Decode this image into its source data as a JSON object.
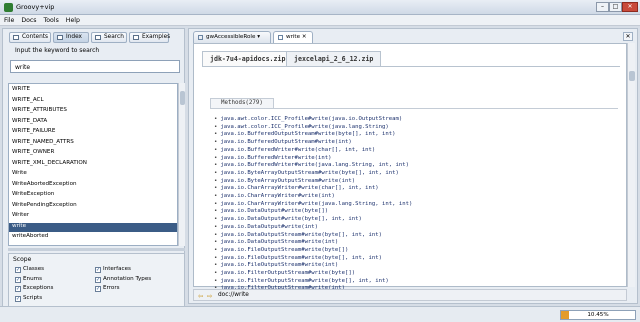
{
  "window": {
    "title": "Groovy+vip"
  },
  "menu": [
    "File",
    "Docs",
    "Tools",
    "Help"
  ],
  "left_tabs": [
    "Contents",
    "Index",
    "Search",
    "Examples"
  ],
  "keyword": {
    "label": "Input the keyword to search",
    "value": "write"
  },
  "index_list": [
    "WRITE",
    "WRITE_ACL",
    "WRITE_ATTRIBUTES",
    "WRITE_DATA",
    "WRITE_FAILURE",
    "WRITE_NAMED_ATTRS",
    "WRITE_OWNER",
    "WRITE_XML_DECLARATION",
    "Write",
    "WriteAbortedException",
    "WriteException",
    "WritePendingException",
    "Writer",
    "write",
    "writeAborted"
  ],
  "selected_index": 13,
  "scope": {
    "title": "Scope",
    "options": [
      {
        "label": "Classes",
        "checked": true
      },
      {
        "label": "Interfaces",
        "checked": true
      },
      {
        "label": "Enums",
        "checked": true
      },
      {
        "label": "Annotation Types",
        "checked": true
      },
      {
        "label": "Exceptions",
        "checked": true
      },
      {
        "label": "Errors",
        "checked": true
      },
      {
        "label": "Scripts",
        "checked": true
      }
    ]
  },
  "doc_tabs": [
    {
      "label": "gwAccessibleRole",
      "active": false
    },
    {
      "label": "write",
      "active": true
    }
  ],
  "jar_tabs": [
    "jdk-7u4-apidocs.zip",
    "jexcelapi_2_6_12.zip"
  ],
  "methods_tab": "Methods(279)",
  "methods": [
    "java.awt.color.ICC_Profile#write(java.io.OutputStream)",
    "java.awt.color.ICC_Profile#write(java.lang.String)",
    "java.io.BufferedOutputStream#write(byte[], int, int)",
    "java.io.BufferedOutputStream#write(int)",
    "java.io.BufferedWriter#write(char[], int, int)",
    "java.io.BufferedWriter#write(int)",
    "java.io.BufferedWriter#write(java.lang.String, int, int)",
    "java.io.ByteArrayOutputStream#write(byte[], int, int)",
    "java.io.ByteArrayOutputStream#write(int)",
    "java.io.CharArrayWriter#write(char[], int, int)",
    "java.io.CharArrayWriter#write(int)",
    "java.io.CharArrayWriter#write(java.lang.String, int, int)",
    "java.io.DataOutput#write(byte[])",
    "java.io.DataOutput#write(byte[], int, int)",
    "java.io.DataOutput#write(int)",
    "java.io.DataOutputStream#write(byte[], int, int)",
    "java.io.DataOutputStream#write(int)",
    "java.io.FileOutputStream#write(byte[])",
    "java.io.FileOutputStream#write(byte[], int, int)",
    "java.io.FileOutputStream#write(int)",
    "java.io.FilterOutputStream#write(byte[])",
    "java.io.FilterOutputStream#write(byte[], int, int)",
    "java.io.FilterOutputStream#write(int)",
    "java.io.FilterWriter#write(char[], int, int)"
  ],
  "address": "doc://write",
  "status": {
    "progress_label": "10.45%",
    "progress": 0.1045
  },
  "colors": {
    "selection": "#3b5c86",
    "progress": "#e39b2a"
  }
}
